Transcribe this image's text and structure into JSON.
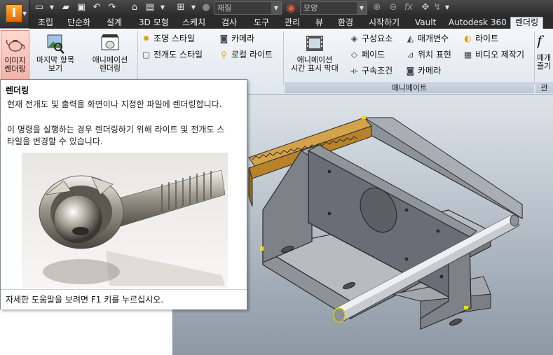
{
  "app": {
    "logo_letter": "I"
  },
  "qat": {
    "material_combo": "재질",
    "appearance_combo": "모양",
    "fx_label": "fx"
  },
  "tabs": [
    {
      "label": "조립"
    },
    {
      "label": "단순화"
    },
    {
      "label": "설계"
    },
    {
      "label": "3D 모형"
    },
    {
      "label": "스케치"
    },
    {
      "label": "검사"
    },
    {
      "label": "도구"
    },
    {
      "label": "관리"
    },
    {
      "label": "뷰"
    },
    {
      "label": "환경"
    },
    {
      "label": "시작하기"
    },
    {
      "label": "Vault"
    },
    {
      "label": "Autodesk 360"
    },
    {
      "label": "렌더링"
    }
  ],
  "ribbon": {
    "render_image": {
      "line1": "이미지",
      "line2": "렌더링"
    },
    "render_last": {
      "line1": "마지막 항목",
      "line2": "보기"
    },
    "render_animation": {
      "line1": "애니메이션",
      "line2": "렌더링"
    },
    "lighting_style": "조명 스타일",
    "scene_style": "전개도 스타일",
    "camera": "카메라",
    "local_light": "로컬 라이트",
    "timeline": {
      "line1": "애니메이션",
      "line2": "시간 표시 막대"
    },
    "component": "구성요소",
    "fade": "페이드",
    "constraint": "구속조건",
    "parameter": "매개변수",
    "position_rep": "위치 표현",
    "anim_camera": "카메라",
    "anim_light": "라이트",
    "video_producer": "비디오 제작기",
    "partial_big": {
      "line1": "매개",
      "line2": "즐기"
    },
    "panel_animate": "애니메이트",
    "panel_partial": "관"
  },
  "tooltip": {
    "title": "렌더링",
    "line1": "현재 전개도 및 출력을 화면이나 지정한 파일에 렌더링합니다.",
    "line2": "이 명령을 실행하는 경우 렌더링하기 위해 라이트 및 전개도 스",
    "line3": "타일을 변경할 수 있습니다.",
    "footer": "자세한 도움말을 보려면 F1 키를 누르십시오."
  },
  "colors": {
    "accent_active_button": "#f4b3a9",
    "ribbon_bg": "#eef2f6",
    "tab_bar": "#2b2b2b",
    "part_gold": "#c8902a",
    "part_gray": "#6f747a"
  }
}
